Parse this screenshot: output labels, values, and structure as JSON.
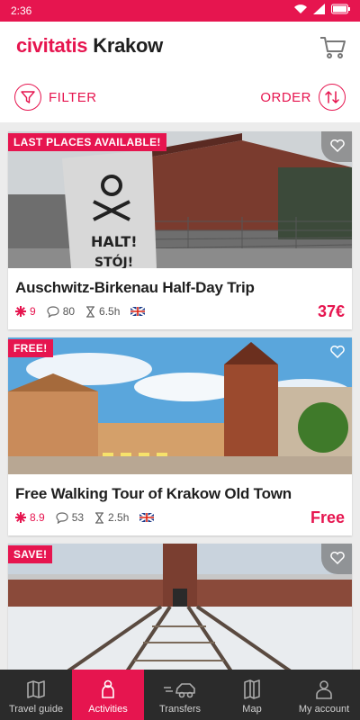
{
  "status": {
    "time": "2:36"
  },
  "header": {
    "brand": "civitatis",
    "city": "Krakow"
  },
  "toolbar": {
    "filter_label": "FILTER",
    "order_label": "ORDER"
  },
  "cards": [
    {
      "badge": "LAST PLACES AVAILABLE!",
      "title": "Auschwitz-Birkenau Half-Day Trip",
      "rating": "9",
      "reviews": "80",
      "duration": "6.5h",
      "price": "37€"
    },
    {
      "badge": "FREE!",
      "title": "Free Walking Tour of Krakow Old Town",
      "rating": "8.9",
      "reviews": "53",
      "duration": "2.5h",
      "price": "Free"
    },
    {
      "badge": "SAVE!"
    }
  ],
  "bottomnav": [
    {
      "label": "Travel guide",
      "icon": "map-book-icon"
    },
    {
      "label": "Activities",
      "icon": "person-icon"
    },
    {
      "label": "Transfers",
      "icon": "car-icon"
    },
    {
      "label": "Map",
      "icon": "map-icon"
    },
    {
      "label": "My account",
      "icon": "user-icon"
    }
  ],
  "colors": {
    "accent": "#e6154f",
    "nav_bg": "#2b2b2b"
  }
}
